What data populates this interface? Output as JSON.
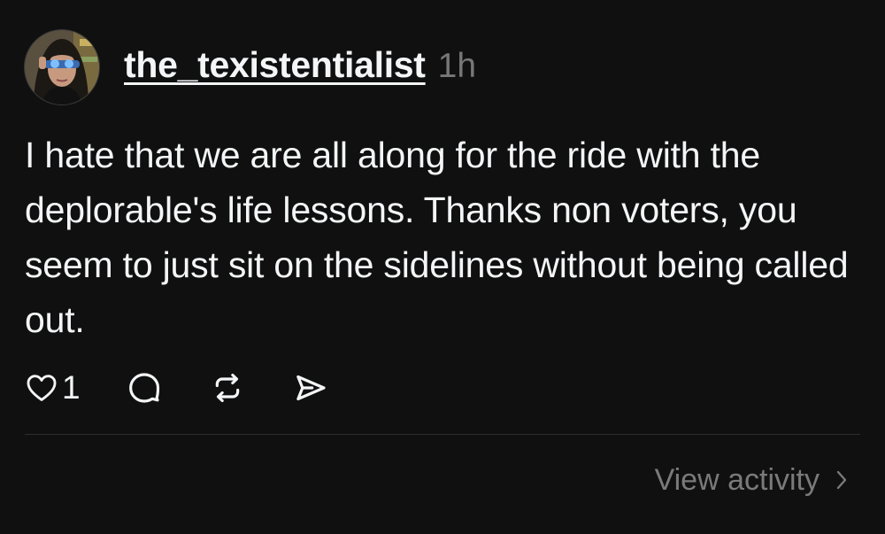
{
  "post": {
    "username": "the_texistentialist",
    "timestamp": "1h",
    "text": "I hate that we are all along for the ride with the deplorable's life lessons. Thanks non voters, you seem to just sit on the sidelines without being called out.",
    "like_count": "1",
    "view_activity_label": "View activity"
  },
  "icons": {
    "like": "heart-icon",
    "reply": "comment-icon",
    "repost": "repost-icon",
    "share": "send-icon",
    "chevron": "chevron-right-icon"
  },
  "colors": {
    "background": "#101010",
    "text_primary": "#f3f5f7",
    "text_secondary": "#777777",
    "divider": "#2d2d2d"
  }
}
